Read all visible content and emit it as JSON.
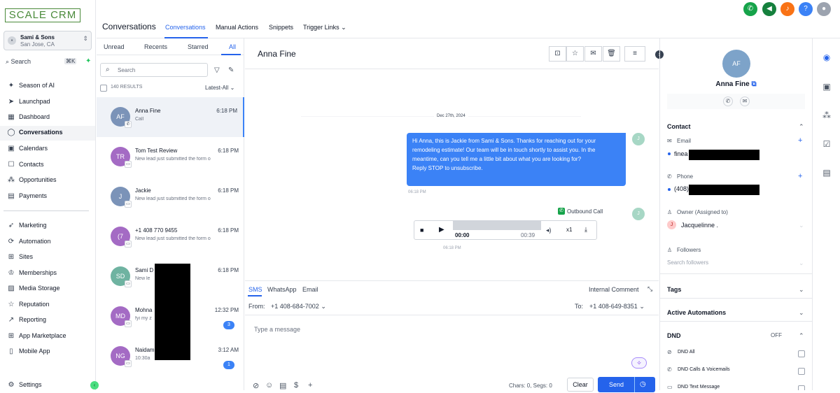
{
  "app": {
    "logo": "SCALE CRM"
  },
  "location": {
    "name": "Sami & Sons",
    "city": "San Jose, CA",
    "chevron": "⌃⌄"
  },
  "sidebar_search": {
    "label": "Search",
    "shortcut": "⌘K",
    "icon": "search-icon"
  },
  "sidebar": {
    "items": [
      {
        "label": "Season of AI",
        "icon": "✦"
      },
      {
        "label": "Launchpad",
        "icon": "➤"
      },
      {
        "label": "Dashboard",
        "icon": "▦"
      },
      {
        "label": "Conversations",
        "icon": "◯"
      },
      {
        "label": "Calendars",
        "icon": "▣"
      },
      {
        "label": "Contacts",
        "icon": "☐"
      },
      {
        "label": "Opportunities",
        "icon": "⁂"
      },
      {
        "label": "Payments",
        "icon": "▤"
      },
      {
        "label": "Marketing",
        "icon": "➶"
      },
      {
        "label": "Automation",
        "icon": "⟳"
      },
      {
        "label": "Sites",
        "icon": "⊞"
      },
      {
        "label": "Memberships",
        "icon": "♔"
      },
      {
        "label": "Media Storage",
        "icon": "▨"
      },
      {
        "label": "Reputation",
        "icon": "☆"
      },
      {
        "label": "Reporting",
        "icon": "↗"
      },
      {
        "label": "App Marketplace",
        "icon": "⊞"
      },
      {
        "label": "Mobile App",
        "icon": "▯"
      },
      {
        "label": "Settings",
        "icon": "⚙"
      }
    ]
  },
  "topbar": {
    "title": "Conversations",
    "tabs": [
      "Conversations",
      "Manual Actions",
      "Snippets",
      "Trigger Links ⌄"
    ]
  },
  "list": {
    "tabs": [
      "Unread",
      "Recents",
      "Starred",
      "All"
    ],
    "search_placeholder": "Search",
    "results": "140 RESULTS",
    "sort": "Latest-All",
    "rows": [
      {
        "initials": "AF",
        "name": "Anna Fine",
        "preview": "Call",
        "time": "6:18 PM",
        "color": "#7b93b8"
      },
      {
        "initials": "TR",
        "name": "Tom Test Review",
        "preview": "New lead just submitted the form o",
        "time": "6:18 PM",
        "color": "#a46bc4"
      },
      {
        "initials": "J",
        "name": "Jackie",
        "preview": "New lead just submitted the form o",
        "time": "6:18 PM",
        "color": "#7b93b8"
      },
      {
        "initials": "(7",
        "name": "+1 408 770 9455",
        "preview": "New lead just submitted the form o",
        "time": "6:18 PM",
        "color": "#a46bc4"
      },
      {
        "initials": "SD",
        "name": "Sami D",
        "preview": "New le",
        "time": "6:18 PM",
        "color": "#6fb3a1"
      },
      {
        "initials": "MD",
        "name": "Mohna",
        "preview": "fyi my z",
        "time": "12:32 PM",
        "color": "#a46bc4",
        "count": "3"
      },
      {
        "initials": "NG",
        "name": "Naidam",
        "preview": "10:30a",
        "time": "3:12 AM",
        "color": "#a46bc4",
        "count": "1"
      }
    ]
  },
  "chat": {
    "contact_name": "Anna Fine",
    "date": "Dec 27th, 2024",
    "message": "Hi Anna, this is Jackie from Sami & Sons. Thanks for reaching out for your remodeling estimate! Our team will be in touch shortly to assist you. In the meantime, can you tell me a little bit about what you are looking for?\nReply STOP to unsubscribe.",
    "message_time": "06:18 PM",
    "sender_initial": "J",
    "call_label": "Outbound Call",
    "call_time": "06:18 PM",
    "player": {
      "current": "00:00",
      "total": "00:39",
      "speed": "x1"
    }
  },
  "composer": {
    "tabs": [
      "SMS",
      "WhatsApp",
      "Email"
    ],
    "internal_comment": "Internal Comment",
    "from_label": "From:",
    "from_number": "+1 408-684-7002",
    "to_label": "To:",
    "to_number": "+1 408-649-8351",
    "placeholder": "Type a message",
    "counter": "Chars: 0, Segs: 0",
    "clear": "Clear",
    "send": "Send"
  },
  "contact": {
    "initials": "AF",
    "name": "Anna Fine",
    "section_contact": "Contact",
    "email_label": "Email",
    "email_value": "finea",
    "phone_label": "Phone",
    "phone_value": "(408)",
    "owner_label": "Owner (Assigned to)",
    "owner_initial": "J",
    "owner_value": "Jacquelinne .",
    "followers_label": "Followers",
    "followers_placeholder": "Search followers",
    "tags": "Tags",
    "automations": "Active Automations",
    "dnd": "DND",
    "dnd_state": "OFF",
    "dnd_items": [
      "DND All",
      "DND Calls & Voicemails",
      "DND Text Message"
    ]
  },
  "colors": {
    "accent": "#2563eb",
    "brand": "#4a8a3a"
  }
}
